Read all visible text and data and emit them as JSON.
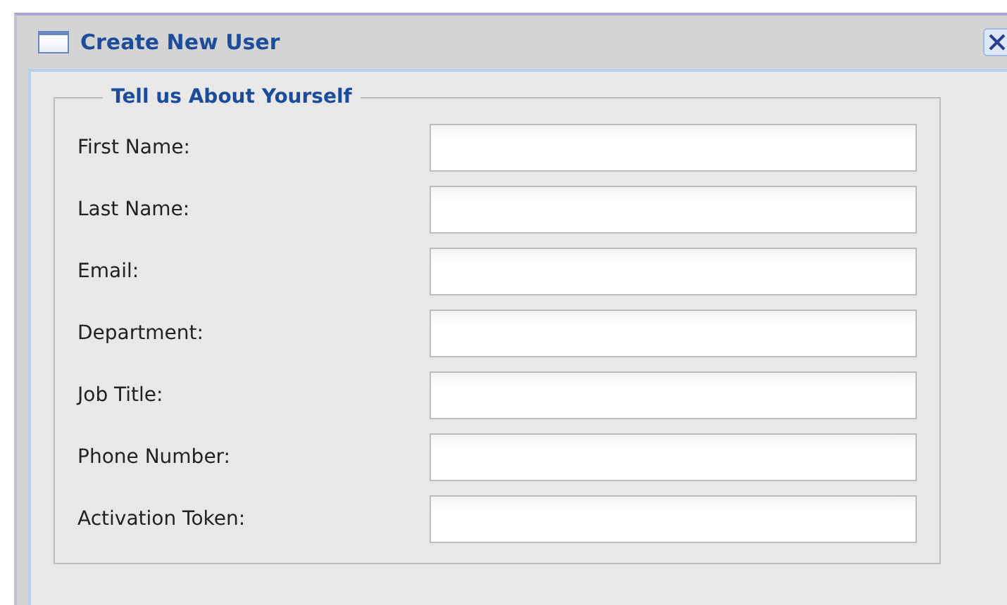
{
  "window": {
    "title": "Create New User"
  },
  "fieldset": {
    "legend": "Tell us About Yourself",
    "fields": [
      {
        "label": "First Name:"
      },
      {
        "label": "Last Name:"
      },
      {
        "label": "Email:"
      },
      {
        "label": "Department:"
      },
      {
        "label": "Job Title:"
      },
      {
        "label": "Phone Number:"
      },
      {
        "label": "Activation Token:"
      }
    ]
  }
}
